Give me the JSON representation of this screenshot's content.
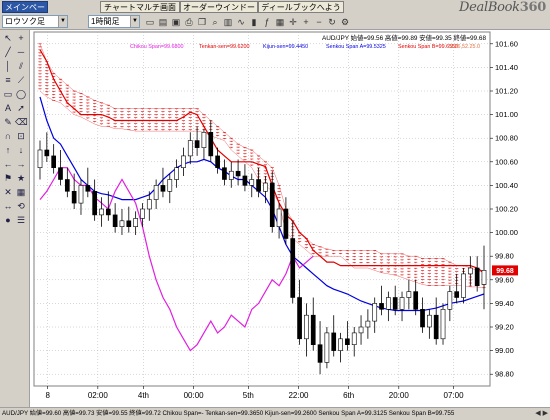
{
  "tabs": [
    {
      "label": "メインページ",
      "active": true
    },
    {
      "label": "チャートマルチ画面",
      "active": false
    },
    {
      "label": "オーダーウインドー",
      "active": false
    },
    {
      "label": "ディールブックへようこそ",
      "active": false
    }
  ],
  "logo": {
    "text": "DealBook",
    "suffix": "360"
  },
  "toolbar": {
    "symbol_value": "ロウソク足",
    "timeframe_value": "1時間足"
  },
  "legend": {
    "ohlc": "AUD/JPY 始値=99.56 高値=99.89 安値=99.35 終値=99.68",
    "chikou": "Chikou Span=99.6800",
    "tenkan": "Tenkan-sen=99.6200",
    "kijun": "Kijun-sen=99.4450",
    "senkou_a": "Senkou Span A=99.5325",
    "senkou_b": "Senkou Span B=99.6550",
    "extra": "9.26,52.25.0"
  },
  "status_text": "AUD/JPY 始値=99.60 高値=99.73 安値=99.55 終値=99.72  Chikou Span=- Tenkan-sen=99.3650 Kijun-sen=99.2600 Senkou Span A=99.3125 Senkou Span B=99.755",
  "price_badge": "99.68",
  "colors": {
    "tenkan": "#e00000",
    "kijun": "#0000e0",
    "chikou": "#e020e0",
    "cloud_hatch": "#e00000",
    "candle_up": "#ffffff",
    "candle_down": "#000000"
  },
  "chart_data": {
    "type": "candlestick",
    "instrument": "AUD/JPY",
    "ylim": [
      98.7,
      101.7
    ],
    "y_ticks": [
      101.6,
      101.4,
      101.2,
      101.0,
      100.8,
      100.6,
      100.4,
      100.2,
      100.0,
      99.8,
      99.6,
      99.4,
      99.2,
      99.0,
      98.8
    ],
    "x_ticks": [
      "8",
      "02:00",
      "4th",
      "00:00",
      "5th",
      "22:00",
      "6th",
      "20:00",
      "07:00"
    ],
    "x_tick_pos": [
      0.03,
      0.14,
      0.24,
      0.35,
      0.47,
      0.58,
      0.69,
      0.8,
      0.92
    ],
    "grid": true,
    "candles": [
      [
        100.55,
        100.78,
        100.45,
        100.7
      ],
      [
        100.7,
        100.85,
        100.6,
        100.65
      ],
      [
        100.65,
        100.75,
        100.5,
        100.55
      ],
      [
        100.55,
        100.7,
        100.4,
        100.45
      ],
      [
        100.45,
        100.55,
        100.3,
        100.35
      ],
      [
        100.35,
        100.5,
        100.2,
        100.25
      ],
      [
        100.25,
        100.45,
        100.15,
        100.4
      ],
      [
        100.4,
        100.55,
        100.3,
        100.35
      ],
      [
        100.35,
        100.45,
        100.1,
        100.15
      ],
      [
        100.15,
        100.3,
        100.05,
        100.2
      ],
      [
        100.2,
        100.35,
        100.1,
        100.15
      ],
      [
        100.15,
        100.25,
        100.0,
        100.05
      ],
      [
        100.05,
        100.2,
        99.98,
        100.1
      ],
      [
        100.1,
        100.22,
        100.0,
        100.05
      ],
      [
        100.05,
        100.18,
        99.98,
        100.12
      ],
      [
        100.12,
        100.25,
        100.05,
        100.2
      ],
      [
        100.2,
        100.35,
        100.1,
        100.28
      ],
      [
        100.28,
        100.45,
        100.2,
        100.4
      ],
      [
        100.4,
        100.55,
        100.3,
        100.35
      ],
      [
        100.35,
        100.5,
        100.25,
        100.45
      ],
      [
        100.45,
        100.62,
        100.38,
        100.55
      ],
      [
        100.55,
        100.72,
        100.48,
        100.65
      ],
      [
        100.65,
        100.85,
        100.58,
        100.78
      ],
      [
        100.78,
        100.9,
        100.65,
        100.72
      ],
      [
        100.72,
        100.88,
        100.62,
        100.85
      ],
      [
        100.85,
        100.95,
        100.6,
        100.65
      ],
      [
        100.65,
        100.72,
        100.5,
        100.55
      ],
      [
        100.55,
        100.62,
        100.4,
        100.45
      ],
      [
        100.45,
        100.6,
        100.38,
        100.52
      ],
      [
        100.52,
        100.62,
        100.4,
        100.48
      ],
      [
        100.48,
        100.58,
        100.35,
        100.4
      ],
      [
        100.4,
        100.5,
        100.3,
        100.45
      ],
      [
        100.45,
        100.55,
        100.3,
        100.35
      ],
      [
        100.35,
        100.48,
        100.25,
        100.42
      ],
      [
        100.42,
        100.52,
        100.0,
        100.05
      ],
      [
        100.05,
        100.25,
        99.95,
        100.2
      ],
      [
        100.2,
        100.3,
        99.9,
        99.95
      ],
      [
        99.95,
        100.1,
        99.4,
        99.45
      ],
      [
        99.45,
        99.6,
        99.05,
        99.1
      ],
      [
        99.1,
        99.4,
        98.95,
        99.3
      ],
      [
        99.3,
        99.45,
        99.0,
        99.05
      ],
      [
        99.05,
        99.25,
        98.8,
        98.9
      ],
      [
        98.9,
        99.2,
        98.85,
        99.15
      ],
      [
        99.15,
        99.3,
        98.95,
        99.0
      ],
      [
        99.0,
        99.15,
        98.9,
        99.1
      ],
      [
        99.1,
        99.25,
        99.0,
        99.05
      ],
      [
        99.05,
        99.2,
        98.95,
        99.15
      ],
      [
        99.15,
        99.3,
        99.05,
        99.2
      ],
      [
        99.2,
        99.35,
        99.1,
        99.25
      ],
      [
        99.25,
        99.45,
        99.15,
        99.4
      ],
      [
        99.4,
        99.55,
        99.3,
        99.35
      ],
      [
        99.35,
        99.5,
        99.25,
        99.45
      ],
      [
        99.45,
        99.55,
        99.3,
        99.35
      ],
      [
        99.35,
        99.5,
        99.25,
        99.45
      ],
      [
        99.45,
        99.6,
        99.35,
        99.5
      ],
      [
        99.5,
        99.6,
        99.3,
        99.35
      ],
      [
        99.35,
        99.45,
        99.15,
        99.2
      ],
      [
        99.2,
        99.35,
        99.1,
        99.3
      ],
      [
        99.3,
        99.45,
        99.05,
        99.1
      ],
      [
        99.1,
        99.4,
        99.05,
        99.35
      ],
      [
        99.35,
        99.55,
        99.25,
        99.5
      ],
      [
        99.5,
        99.65,
        99.4,
        99.45
      ],
      [
        99.45,
        99.7,
        99.4,
        99.65
      ],
      [
        99.65,
        99.8,
        99.55,
        99.7
      ],
      [
        99.7,
        99.8,
        99.5,
        99.55
      ],
      [
        99.56,
        99.89,
        99.35,
        99.68
      ]
    ],
    "series": [
      {
        "name": "Tenkan-sen",
        "values": [
          101.55,
          101.45,
          101.3,
          101.2,
          101.1,
          101.05,
          101.0,
          101.0,
          101.0,
          101.0,
          100.98,
          100.95,
          100.95,
          100.95,
          100.95,
          100.95,
          100.95,
          100.95,
          100.95,
          100.95,
          100.95,
          100.98,
          101.02,
          101.0,
          100.9,
          100.8,
          100.7,
          100.65,
          100.6,
          100.6,
          100.6,
          100.6,
          100.58,
          100.56,
          100.4,
          100.25,
          100.15,
          100.1,
          100.0,
          99.95,
          99.85,
          99.8,
          99.75,
          99.75,
          99.72,
          99.72,
          99.72,
          99.72,
          99.72,
          99.72,
          99.72,
          99.72,
          99.72,
          99.72,
          99.72,
          99.72,
          99.72,
          99.72,
          99.72,
          99.72,
          99.72,
          99.72,
          99.72,
          99.72,
          99.7,
          99.66
        ]
      },
      {
        "name": "Kijun-sen",
        "values": [
          101.15,
          100.95,
          100.8,
          100.75,
          100.65,
          100.55,
          100.45,
          100.4,
          100.35,
          100.33,
          100.32,
          100.3,
          100.28,
          100.28,
          100.28,
          100.3,
          100.32,
          100.38,
          100.45,
          100.5,
          100.55,
          100.58,
          100.6,
          100.6,
          100.62,
          100.6,
          100.55,
          100.52,
          100.48,
          100.45,
          100.45,
          100.4,
          100.35,
          100.3,
          100.2,
          100.05,
          99.9,
          99.8,
          99.75,
          99.7,
          99.65,
          99.6,
          99.55,
          99.52,
          99.5,
          99.48,
          99.45,
          99.42,
          99.4,
          99.38,
          99.36,
          99.35,
          99.34,
          99.34,
          99.34,
          99.34,
          99.34,
          99.35,
          99.36,
          99.38,
          99.4,
          99.41,
          99.42,
          99.44,
          99.46,
          99.48
        ]
      },
      {
        "name": "Chikou Span",
        "values": [
          100.28,
          100.35,
          100.45,
          100.55,
          100.55,
          100.45,
          100.4,
          100.4,
          100.3,
          100.25,
          100.2,
          100.35,
          100.45,
          100.35,
          100.25,
          100.05,
          99.8,
          99.6,
          99.45,
          99.35,
          99.2,
          99.1,
          99.0,
          99.05,
          99.15,
          99.25,
          99.15,
          99.2,
          99.3,
          99.25,
          99.2,
          99.35,
          99.4,
          99.5,
          99.6,
          99.55,
          99.65,
          99.8,
          99.7,
          99.75,
          99.8
        ]
      },
      {
        "name": "Senkou Span A",
        "values": [
          101.2,
          101.15,
          101.12,
          101.1,
          101.05,
          101.0,
          100.98,
          100.95,
          100.92,
          100.9,
          100.9,
          100.88,
          100.88,
          100.87,
          100.86,
          100.86,
          100.86,
          100.86,
          100.86,
          100.86,
          100.86,
          100.86,
          100.86,
          100.86,
          100.85,
          100.82,
          100.8,
          100.78,
          100.7,
          100.65,
          100.6,
          100.55,
          100.45,
          100.4,
          100.35,
          100.25,
          100.0,
          99.95,
          99.9,
          99.85,
          99.8,
          99.8,
          99.8,
          99.8,
          99.8,
          99.75,
          99.7,
          99.7,
          99.7,
          99.68,
          99.66,
          99.65,
          99.64,
          99.62,
          99.6,
          99.58,
          99.56,
          99.55,
          99.55,
          99.55,
          99.55,
          99.55,
          99.55,
          99.54,
          99.54,
          99.53
        ]
      },
      {
        "name": "Senkou Span B",
        "values": [
          101.6,
          101.45,
          101.35,
          101.3,
          101.25,
          101.2,
          101.18,
          101.15,
          101.12,
          101.1,
          101.08,
          101.05,
          101.05,
          101.05,
          101.05,
          101.05,
          101.05,
          101.05,
          101.05,
          101.05,
          101.05,
          101.05,
          101.05,
          101.05,
          101.0,
          100.95,
          100.9,
          100.85,
          100.8,
          100.75,
          100.72,
          100.7,
          100.65,
          100.6,
          100.55,
          100.4,
          100.2,
          100.1,
          100.0,
          99.95,
          99.9,
          99.88,
          99.86,
          99.85,
          99.85,
          99.85,
          99.85,
          99.85,
          99.85,
          99.85,
          99.82,
          99.82,
          99.82,
          99.82,
          99.8,
          99.8,
          99.78,
          99.78,
          99.78,
          99.78,
          99.75,
          99.72,
          99.72,
          99.7,
          99.68,
          99.66
        ]
      }
    ]
  }
}
